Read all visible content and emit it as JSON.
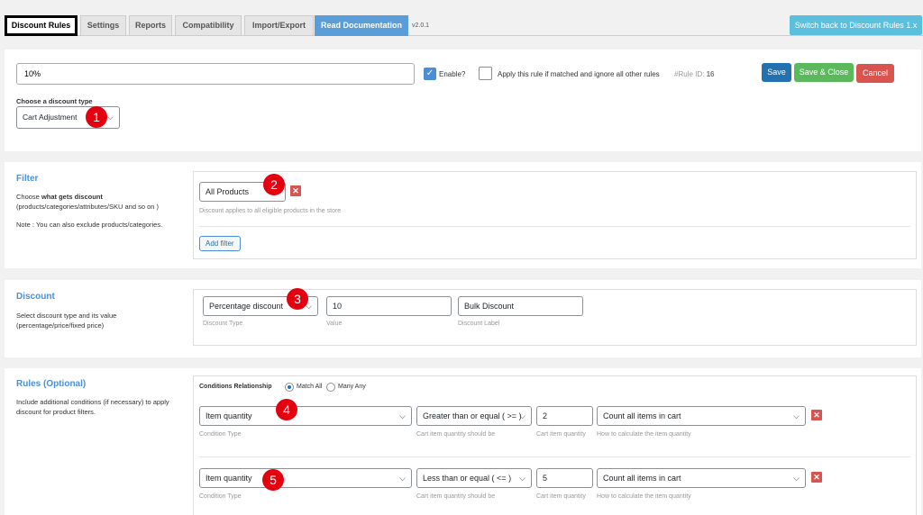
{
  "tabs": [
    {
      "label": "Discount Rules",
      "active": true
    },
    {
      "label": "Settings"
    },
    {
      "label": "Reports"
    },
    {
      "label": "Compatibility"
    },
    {
      "label": "Import/Export"
    },
    {
      "label": "Read Documentation"
    }
  ],
  "version": "v2.0.1",
  "switch_button": "Switch back to Discount Rules 1.x",
  "rule": {
    "title_value": "10%",
    "enable_label": "Enable?",
    "enable_checked": true,
    "exclusive_label": "Apply this rule if matched and ignore all other rules",
    "rule_id_prefix": "#Rule ID:",
    "rule_id": "16",
    "save": "Save",
    "save_close": "Save & Close",
    "cancel": "Cancel",
    "type_label": "Choose a discount type",
    "type_value": "Cart Adjustment"
  },
  "filter": {
    "title": "Filter",
    "desc_prefix": "Choose ",
    "desc_bold": "what gets discount",
    "desc_rest": "(products/categories/attributes/SKU and so on )",
    "note": "Note : You can also exclude products/categories.",
    "value": "All Products",
    "hint": "Discount applies to all eligible products in the store",
    "add_filter": "Add filter"
  },
  "discount": {
    "title": "Discount",
    "desc": "Select discount type and its value (percentage/price/fixed price)",
    "type_value": "Percentage discount",
    "type_hint": "Discount Type",
    "value": "10",
    "value_hint": "Value",
    "label_value": "Bulk Discount",
    "label_hint": "Discount Label"
  },
  "rules": {
    "title": "Rules (Optional)",
    "desc": "Include additional conditions (if necessary) to apply discount for product filters.",
    "relationship_label": "Conditions Relationship",
    "match_all": "Match All",
    "match_any": "Many Any",
    "conditions": [
      {
        "type": "Item quantity",
        "operator": "Greater than or equal ( >= )",
        "qty": "2",
        "calc": "Count all items in cart"
      },
      {
        "type": "Item quantity",
        "operator": "Less than or equal ( <= )",
        "qty": "5",
        "calc": "Count all items in cart"
      }
    ],
    "hint_type": "Condition Type",
    "hint_operator": "Cart item quantity should be",
    "hint_qty": "Cart item quantity",
    "hint_calc": "How to calculate the item quantity"
  },
  "markers": [
    "1",
    "2",
    "3",
    "4",
    "5"
  ],
  "colors": {
    "accent": "#4a90d6",
    "save": "#2271b1",
    "save_close": "#5cb85c",
    "cancel": "#d9534f",
    "marker": "#e3000f",
    "switch": "#5bc0de"
  }
}
